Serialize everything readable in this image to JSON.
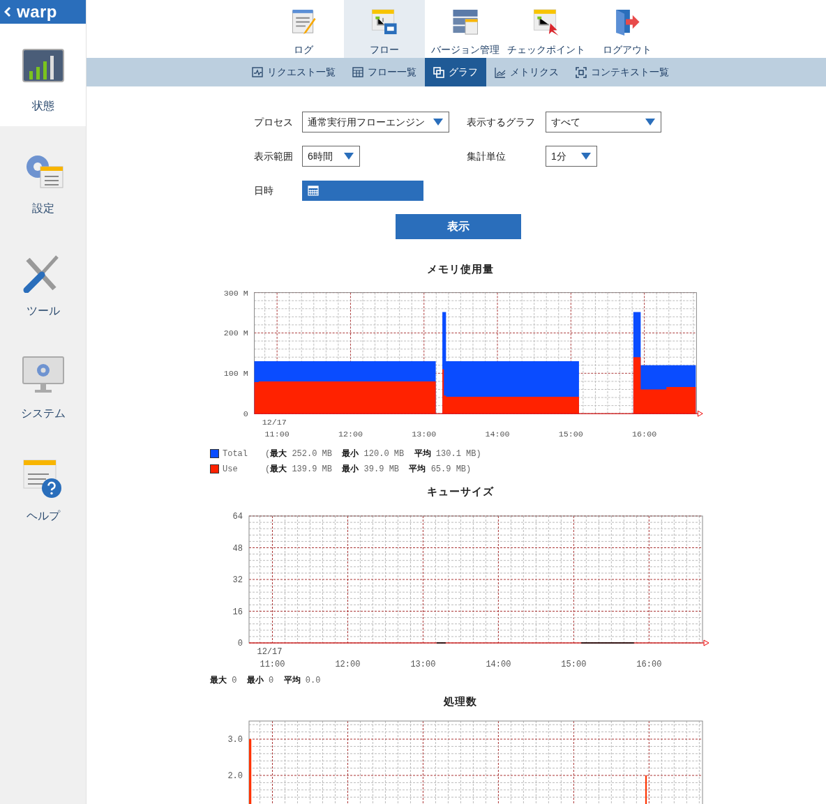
{
  "app": {
    "logo": "warp"
  },
  "sidebar": {
    "items": [
      {
        "label": "状態",
        "selected": true
      },
      {
        "label": "設定",
        "selected": false
      },
      {
        "label": "ツール",
        "selected": false
      },
      {
        "label": "システム",
        "selected": false
      },
      {
        "label": "ヘルプ",
        "selected": false
      }
    ]
  },
  "top_tabs": [
    {
      "label": "ログ",
      "selected": false
    },
    {
      "label": "フロー",
      "selected": true
    },
    {
      "label": "バージョン管理",
      "selected": false
    },
    {
      "label": "チェックポイント",
      "selected": false
    },
    {
      "label": "ログアウト",
      "selected": false
    }
  ],
  "sub_tabs": [
    {
      "label": "リクエスト一覧",
      "selected": false
    },
    {
      "label": "フロー一覧",
      "selected": false
    },
    {
      "label": "グラフ",
      "selected": true
    },
    {
      "label": "メトリクス",
      "selected": false
    },
    {
      "label": "コンテキスト一覧",
      "selected": false
    }
  ],
  "form": {
    "process": {
      "label": "プロセス",
      "value": "通常実行用フローエンジン"
    },
    "graph": {
      "label": "表示するグラフ",
      "value": "すべて"
    },
    "range": {
      "label": "表示範囲",
      "value": "6時間"
    },
    "unit": {
      "label": "集計単位",
      "value": "1分"
    },
    "datetime": {
      "label": "日時"
    },
    "submit": "表示"
  },
  "charts": [
    {
      "title": "メモリ使用量",
      "date_label": "12/17",
      "chart_data": {
        "type": "area",
        "grid": true,
        "x": [
          10.69,
          10.75,
          13.16,
          13.17,
          13.24,
          13.25,
          13.27,
          13.3,
          15.11,
          15.12,
          15.84,
          15.85,
          15.92,
          15.95,
          16.3,
          16.7
        ],
        "series": [
          {
            "name": "Total",
            "color": "#0a4cff",
            "values": [
              130,
              130,
              130,
              null,
              null,
              252,
              252,
              130,
              130,
              null,
              null,
              252,
              252,
              120,
              120,
              120
            ]
          },
          {
            "name": "Use",
            "color": "#ff2200",
            "values": [
              78,
              80,
              82,
              null,
              null,
              110,
              45,
              42,
              45,
              null,
              null,
              140,
              140,
              60,
              66,
              70
            ]
          }
        ],
        "xlim": [
          10.69,
          16.71
        ],
        "ylim": [
          0,
          300
        ],
        "xticks": [
          {
            "value": 11,
            "label": "11:00"
          },
          {
            "value": 12,
            "label": "12:00"
          },
          {
            "value": 13,
            "label": "13:00"
          },
          {
            "value": 14,
            "label": "14:00"
          },
          {
            "value": 15,
            "label": "15:00"
          },
          {
            "value": 16,
            "label": "16:00"
          }
        ],
        "yticks": [
          {
            "value": 0,
            "label": "0"
          },
          {
            "value": 100,
            "label": "100 M"
          },
          {
            "value": 200,
            "label": "200 M"
          },
          {
            "value": 300,
            "label": "300 M"
          }
        ]
      },
      "legend": [
        {
          "stats": "(**最大** 252.0 MB  **最小** 120.0 MB  **平均** 130.1 MB)"
        },
        {
          "stats": "(**最大** 139.9 MB  **最小** 39.9 MB  **平均** 65.9 MB)"
        }
      ]
    },
    {
      "title": "キューサイズ",
      "date_label": "12/17",
      "chart_data": {
        "type": "line",
        "grid": true,
        "x": [
          13.18,
          13.3,
          13.31,
          15.1,
          15.8
        ],
        "series": [
          {
            "color": "#000000",
            "values": [
              0,
              0,
              null,
              0,
              0
            ]
          }
        ],
        "xlim": [
          10.69,
          16.71
        ],
        "ylim": [
          0,
          64
        ],
        "xticks": [
          {
            "value": 11,
            "label": "11:00"
          },
          {
            "value": 12,
            "label": "12:00"
          },
          {
            "value": 13,
            "label": "13:00"
          },
          {
            "value": 14,
            "label": "14:00"
          },
          {
            "value": 15,
            "label": "15:00"
          },
          {
            "value": 16,
            "label": "16:00"
          }
        ],
        "yticks": [
          0,
          16,
          32,
          48,
          64
        ]
      },
      "summary": "**最大** 0  **最小** 0  **平均** 0.0"
    },
    {
      "title": "処理数",
      "chart_data": {
        "type": "area",
        "grid": true,
        "x": [
          10.69,
          10.7,
          10.72,
          15.93,
          15.95,
          15.97,
          16.7
        ],
        "series": [
          {
            "color": "#ff3300",
            "values": [
              3.0,
              3.0,
              0,
              0,
              2.0,
              0,
              0
            ]
          }
        ],
        "xlim": [
          10.69,
          16.71
        ],
        "ylim": [
          0,
          3.5
        ],
        "yticks": [
          {
            "value": 2,
            "label": "2.0"
          },
          {
            "value": 3,
            "label": "3.0"
          }
        ]
      }
    }
  ]
}
